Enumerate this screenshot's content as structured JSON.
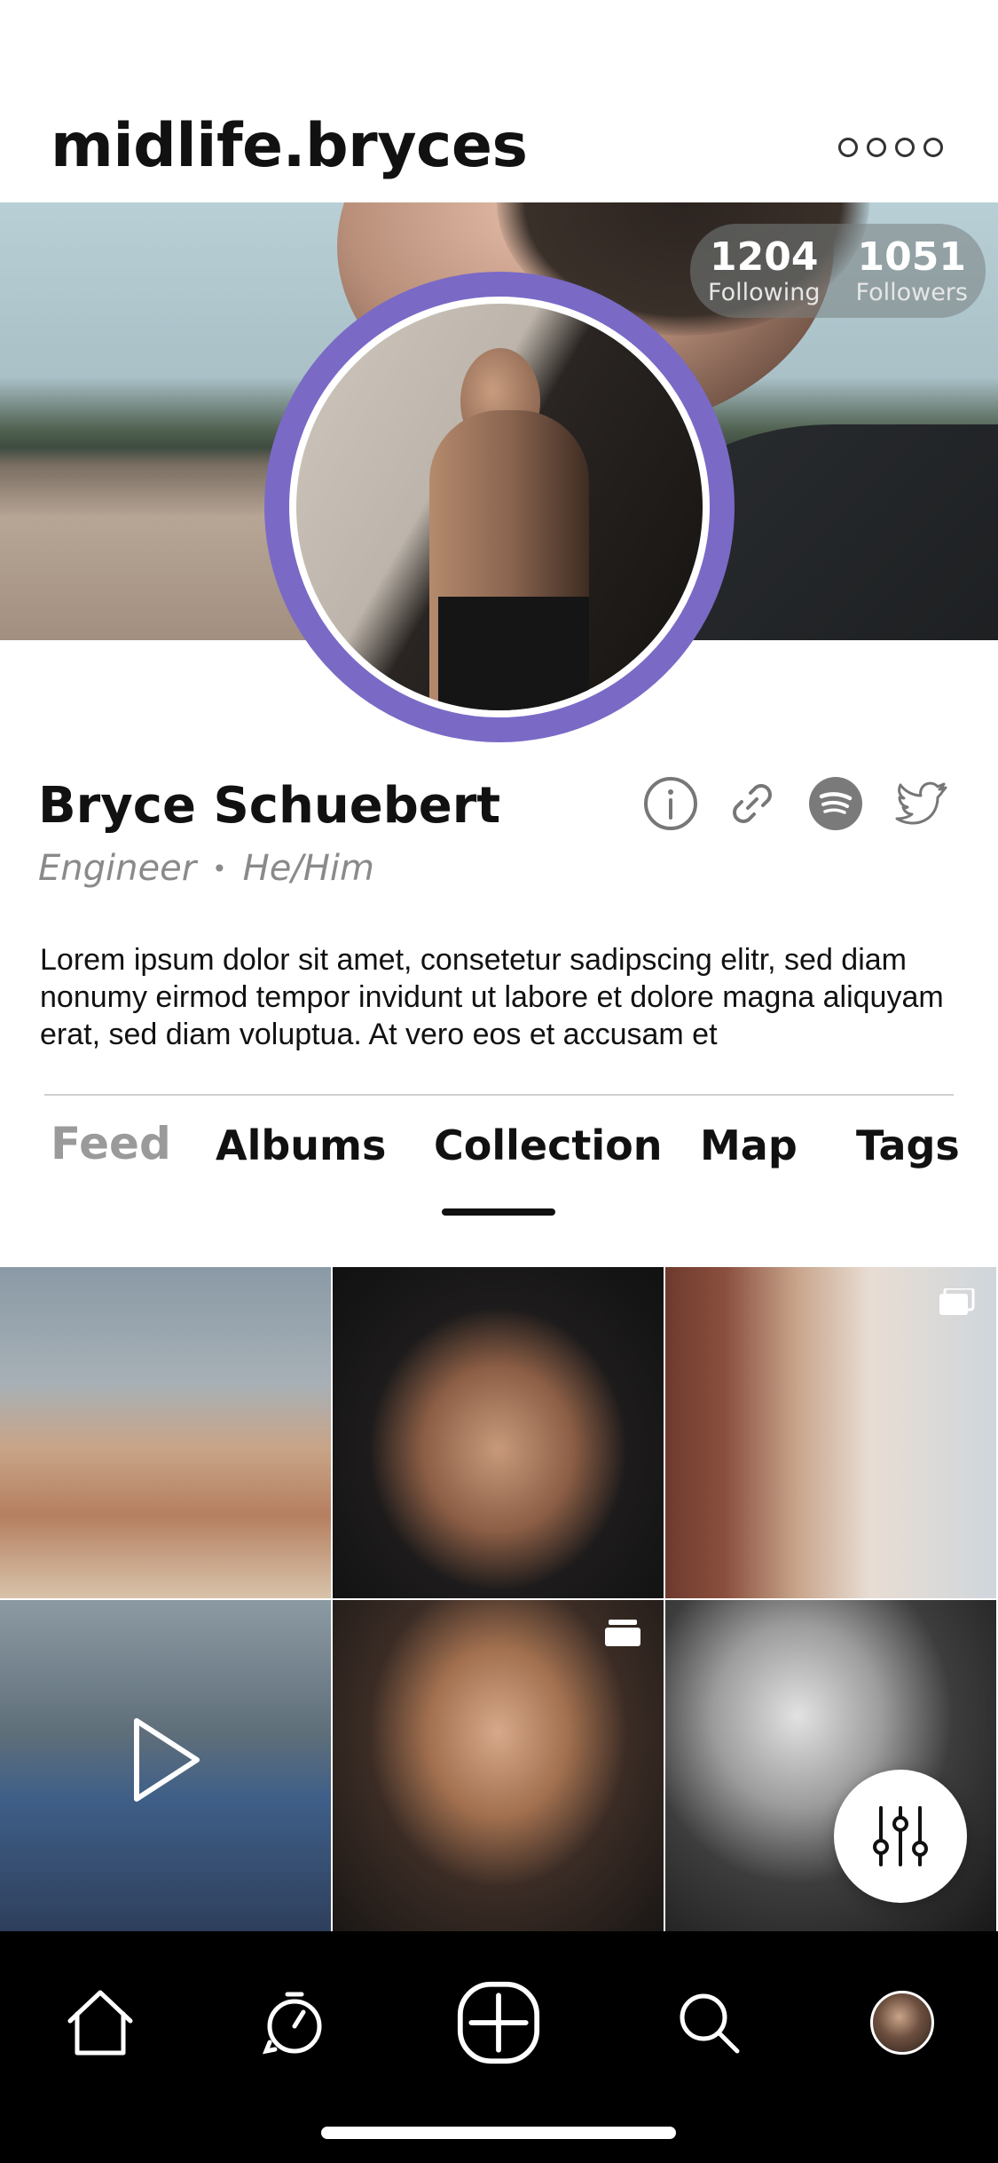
{
  "header": {
    "username": "midlife.bryces",
    "more_icon": "more-dots-icon"
  },
  "stats": {
    "following": {
      "value": "1204",
      "label": "Following"
    },
    "followers": {
      "value": "1051",
      "label": "Followers"
    }
  },
  "profile": {
    "name": "Bryce Schuebert",
    "role": "Engineer",
    "separator": "•",
    "pronouns": "He/Him",
    "icons": [
      "info-icon",
      "link-icon",
      "spotify-icon",
      "twitter-icon"
    ],
    "bio": "Lorem ipsum dolor sit amet, consetetur sadipscing elitr, sed diam nonumy eirmod tempor invidunt ut labore et dolore magna aliquyam erat, sed diam voluptua. At vero eos et accusam et"
  },
  "tabs": [
    {
      "label": "Feed"
    },
    {
      "label": "Albums"
    },
    {
      "label": "Collection"
    },
    {
      "label": "Map"
    },
    {
      "label": "Tags"
    }
  ],
  "active_tab": "Collection",
  "grid": [
    {
      "type": "photo"
    },
    {
      "type": "photo"
    },
    {
      "type": "album"
    },
    {
      "type": "video"
    },
    {
      "type": "album"
    },
    {
      "type": "photo"
    }
  ],
  "fab_icon": "filter-sliders-icon",
  "bottom_nav": [
    "home-icon",
    "activity-icon",
    "create-icon",
    "search-icon",
    "profile-avatar"
  ],
  "colors": {
    "accent": "#7a6ac6",
    "nav_background": "#000000",
    "muted_text": "#8a8a8a"
  }
}
